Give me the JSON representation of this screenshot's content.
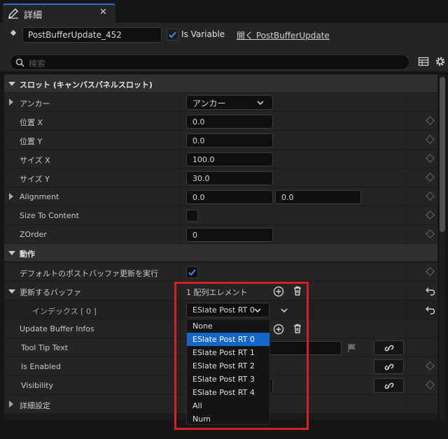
{
  "tab": {
    "label": "詳細"
  },
  "header": {
    "name_value": "PostBufferUpdate_452",
    "is_variable_label": "Is Variable",
    "open_link": "開く PostBufferUpdate",
    "search_placeholder": "検索"
  },
  "sections": {
    "slot": "スロット (キャンバスパネルスロット)",
    "behavior": "動作",
    "advanced": "詳細設定"
  },
  "rows": {
    "anchor": {
      "label": "アンカー",
      "value": "アンカー"
    },
    "pos_x": {
      "label": "位置 X",
      "value": "0.0"
    },
    "pos_y": {
      "label": "位置 Y",
      "value": "0.0"
    },
    "size_x": {
      "label": "サイズ X",
      "value": "100.0"
    },
    "size_y": {
      "label": "サイズ Y",
      "value": "30.0"
    },
    "alignment": {
      "label": "Alignment",
      "value_x": "0.0",
      "value_y": "0.0"
    },
    "size_to_content": {
      "label": "Size To Content"
    },
    "zorder": {
      "label": "ZOrder",
      "value": "0"
    },
    "default_post_buffer": {
      "label": "デフォルトのポストバッファ更新を実行"
    },
    "buffers_to_update": {
      "label": "更新するバッファ",
      "count": "1 配列エレメント"
    },
    "index0": {
      "label": "インデックス [ 0 ]",
      "value": "ESlate Post RT 0"
    },
    "update_buffer_infos": {
      "label": "Update Buffer Infos"
    },
    "tool_tip_text": {
      "label": "Tool Tip Text"
    },
    "is_enabled": {
      "label": "Is Enabled"
    },
    "visibility": {
      "label": "Visibility"
    }
  },
  "dropdown": {
    "options": [
      "None",
      "ESlate Post RT 0",
      "ESlate Post RT 1",
      "ESlate Post RT 2",
      "ESlate Post RT 3",
      "ESlate Post RT 4",
      "All",
      "Num"
    ],
    "selected": "ESlate Post RT 0"
  },
  "colors": {
    "accent": "#1467c8",
    "highlight": "#d92020",
    "panel": "#242424"
  }
}
